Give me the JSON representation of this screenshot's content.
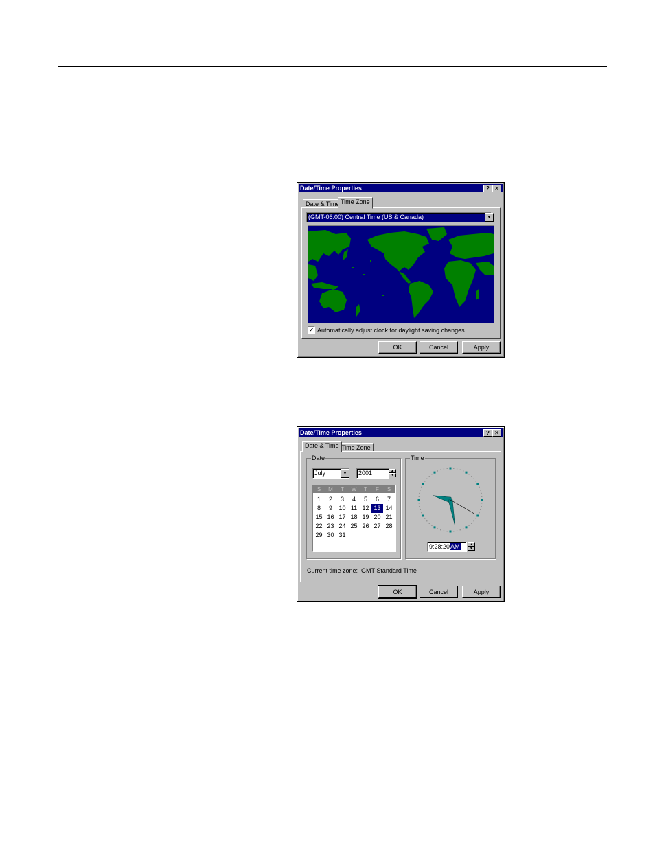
{
  "tz_dialog": {
    "title": "Date/Time Properties",
    "help_label": "?",
    "close_label": "✕",
    "tabs": [
      {
        "label": "Date & Time"
      },
      {
        "label": "Time Zone"
      }
    ],
    "active_tab": "Time Zone",
    "timezone_value": "(GMT-06:00) Central Time (US & Canada)",
    "dropdown_arrow": "▼",
    "dst_checked": true,
    "dst_check_mark": "✔",
    "dst_label": "Automatically adjust clock for daylight saving changes",
    "map_colors": {
      "ocean": "#000080",
      "land": "#008000"
    },
    "buttons": {
      "ok": "OK",
      "cancel": "Cancel",
      "apply": "Apply"
    }
  },
  "dt_dialog": {
    "title": "Date/Time Properties",
    "help_label": "?",
    "close_label": "✕",
    "tabs": [
      {
        "label": "Date & Time"
      },
      {
        "label": "Time Zone"
      }
    ],
    "active_tab": "Date & Time",
    "date_group_label": "Date",
    "time_group_label": "Time",
    "month": "July",
    "dropdown_arrow": "▼",
    "year": "2001",
    "spin_up": "▲",
    "spin_down": "▼",
    "weekdays": [
      "S",
      "M",
      "T",
      "W",
      "T",
      "F",
      "S"
    ],
    "calendar_rows": [
      [
        "1",
        "2",
        "3",
        "4",
        "5",
        "6",
        "7"
      ],
      [
        "8",
        "9",
        "10",
        "11",
        "12",
        "13",
        "14"
      ],
      [
        "15",
        "16",
        "17",
        "18",
        "19",
        "20",
        "21"
      ],
      [
        "22",
        "23",
        "24",
        "25",
        "26",
        "27",
        "28"
      ],
      [
        "29",
        "30",
        "31",
        "",
        "",
        "",
        ""
      ]
    ],
    "selected_day": "13",
    "time_value": "9:28:20",
    "ampm": "AM",
    "clock": {
      "hour": 9,
      "minute": 28,
      "second": 20
    },
    "clock_hand_color": "#008080",
    "current_tz_label": "Current time zone:",
    "current_tz_value": "GMT Standard Time",
    "buttons": {
      "ok": "OK",
      "cancel": "Cancel",
      "apply": "Apply"
    }
  }
}
